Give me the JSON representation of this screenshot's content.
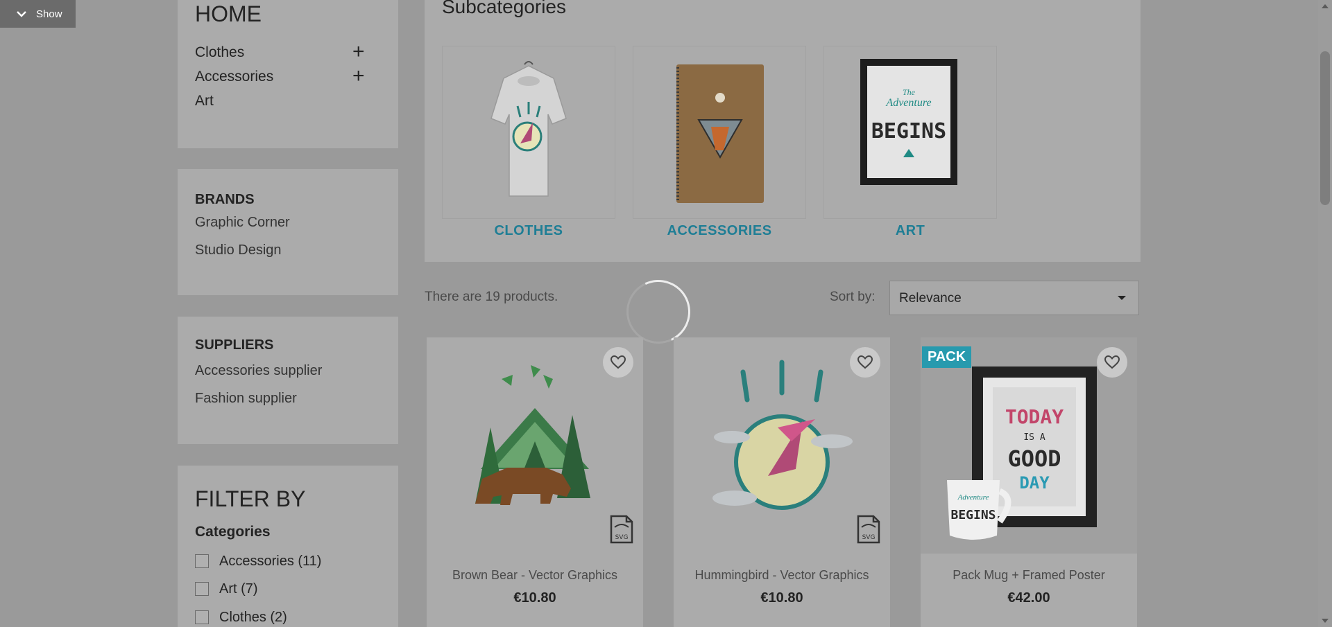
{
  "toggle": {
    "label": "Show"
  },
  "sidebar": {
    "home_title": "HOME",
    "categories": [
      {
        "label": "Clothes",
        "expandable": true
      },
      {
        "label": "Accessories",
        "expandable": true
      },
      {
        "label": "Art",
        "expandable": false
      }
    ],
    "brands": {
      "title": "BRANDS",
      "items": [
        "Graphic Corner",
        "Studio Design"
      ]
    },
    "suppliers": {
      "title": "SUPPLIERS",
      "items": [
        "Accessories supplier",
        "Fashion supplier"
      ]
    },
    "filter": {
      "title": "FILTER BY",
      "facet_title": "Categories",
      "options": [
        "Accessories (11)",
        "Art (7)",
        "Clothes (2)"
      ]
    }
  },
  "subcategories": {
    "title": "Subcategories",
    "items": [
      {
        "name": "CLOTHES",
        "image": "t-shirt-hummingbird"
      },
      {
        "name": "ACCESSORIES",
        "image": "notebook-fox"
      },
      {
        "name": "ART",
        "image": "framed-poster-adventure-begins"
      }
    ]
  },
  "listing": {
    "count_text": "There are 19 products.",
    "sort_label": "Sort by:",
    "sort_value": "Relevance"
  },
  "products": [
    {
      "name": "Brown Bear - Vector Graphics",
      "price": "€10.80",
      "badge": "",
      "format_icon": "SVG"
    },
    {
      "name": "Hummingbird - Vector Graphics",
      "price": "€10.80",
      "badge": "",
      "format_icon": "SVG"
    },
    {
      "name": "Pack Mug + Framed Poster",
      "price": "€42.00",
      "badge": "PACK",
      "format_icon": ""
    }
  ],
  "poster_text": {
    "adventure_1": "The",
    "adventure_2": "Adventure",
    "adventure_3": "BEGINS",
    "today_1": "TODAY",
    "today_2": "IS A",
    "today_3": "GOOD",
    "today_4": "DAY"
  },
  "colors": {
    "accent": "#279aae",
    "link": "#1f7e95",
    "overlay": "#9a9a9a"
  }
}
